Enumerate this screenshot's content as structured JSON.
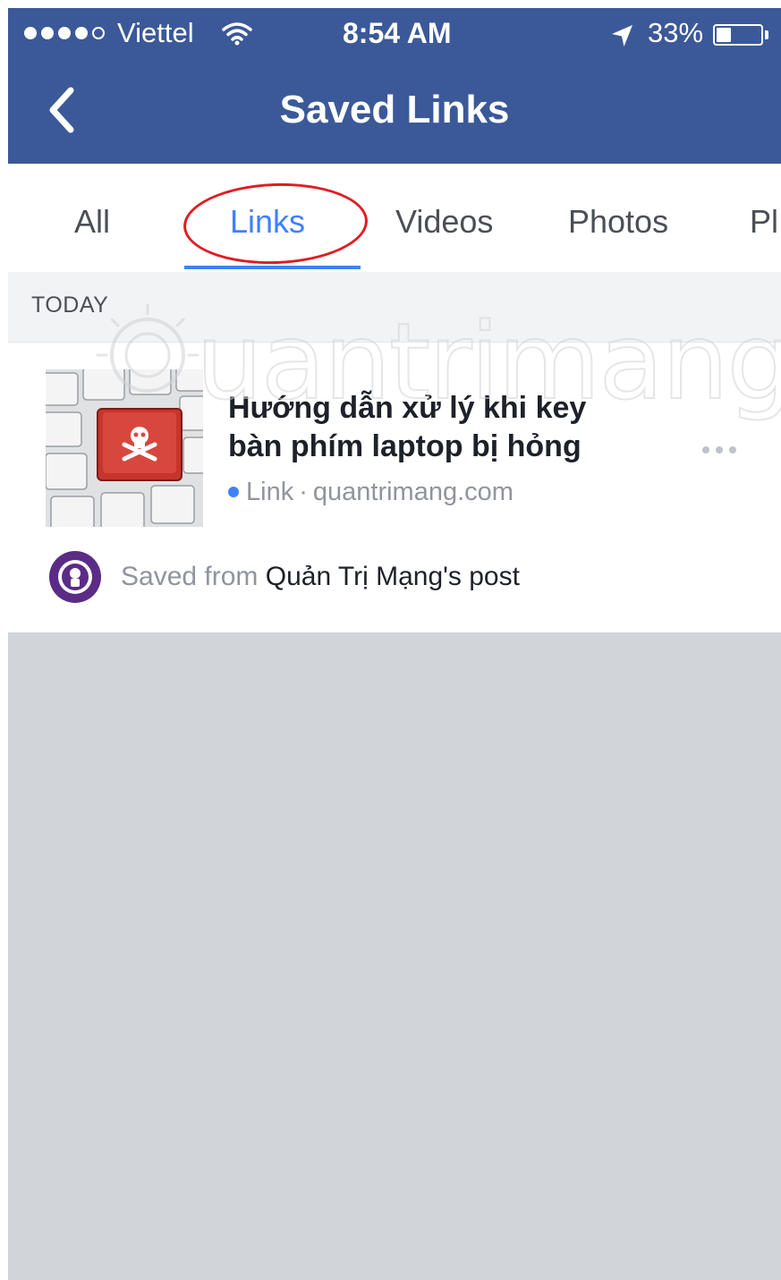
{
  "status_bar": {
    "carrier": "Viettel",
    "time": "8:54 AM",
    "battery_percent": "33%",
    "battery_level": 0.33,
    "signal_bars_filled": 4,
    "signal_bars_total": 5,
    "icons": [
      "wifi-icon",
      "location-arrow-icon",
      "battery-icon"
    ]
  },
  "header": {
    "title": "Saved Links",
    "back_icon": "chevron-left-icon",
    "background_color": "#3b5998"
  },
  "tabs": {
    "items": [
      {
        "label": "All",
        "active": false
      },
      {
        "label": "Links",
        "active": true
      },
      {
        "label": "Videos",
        "active": false
      },
      {
        "label": "Photos",
        "active": false
      },
      {
        "label": "Pl",
        "active": false
      }
    ],
    "active_color": "#4080ff",
    "annotation_color": "#e11b22"
  },
  "section": {
    "label": "TODAY"
  },
  "saved_item": {
    "title": "Hướng dẫn xử lý khi key bàn phím laptop bị hỏng",
    "type": "Link",
    "separator": " · ",
    "domain": "quantrimang.com",
    "saved_from_prefix": "Saved from",
    "saved_from_source": "Quản Trị Mạng's post",
    "thumbnail_icon": "keyboard-skull-key-image",
    "more_icon": "more-options-icon",
    "avatar_icon": "page-avatar-icon"
  },
  "watermark": {
    "text": "uantrimang"
  }
}
